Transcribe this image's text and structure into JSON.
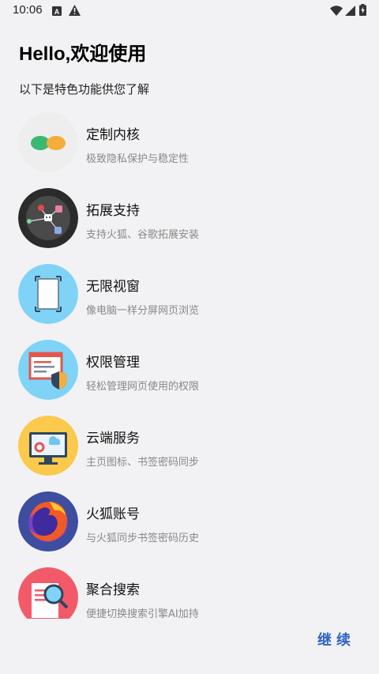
{
  "status_bar": {
    "time": "10:06"
  },
  "header": {
    "title": "Hello,欢迎使用",
    "subtitle": "以下是特色功能供您了解"
  },
  "features": [
    {
      "title": "定制内核",
      "desc": "极致隐私保护与稳定性",
      "icon": "kernel-icon"
    },
    {
      "title": "拓展支持",
      "desc": "支持火狐、谷歌拓展安装",
      "icon": "extension-icon"
    },
    {
      "title": "无限视窗",
      "desc": "像电脑一样分屏网页浏览",
      "icon": "window-icon"
    },
    {
      "title": "权限管理",
      "desc": "轻松管理网页使用的权限",
      "icon": "permission-icon"
    },
    {
      "title": "云端服务",
      "desc": "主页图标、书签密码同步",
      "icon": "cloud-icon"
    },
    {
      "title": "火狐账号",
      "desc": "与火狐同步书签密码历史",
      "icon": "firefox-icon"
    },
    {
      "title": "聚合搜索",
      "desc": "便捷切换搜索引擎AI加持",
      "icon": "search-icon"
    }
  ],
  "actions": {
    "continue_label": "继续"
  },
  "colors": {
    "accent": "#2f63c7",
    "background": "#f2f2f4"
  }
}
